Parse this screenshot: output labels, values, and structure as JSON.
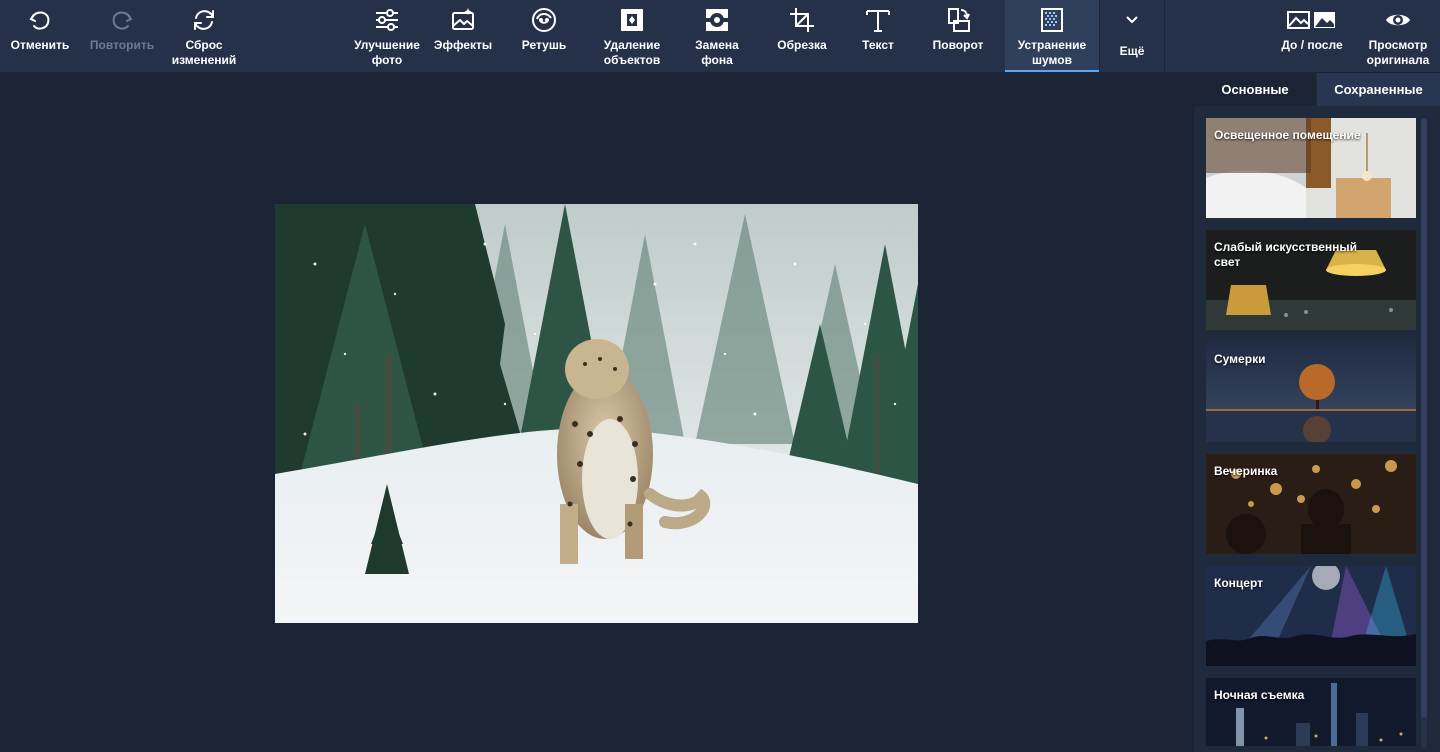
{
  "toolbar": {
    "undo": "Отменить",
    "redo": "Повторить",
    "reset": "Сброс\nизменений",
    "enhance": "Улучшение\nфото",
    "effects": "Эффекты",
    "retouch": "Ретушь",
    "remove_objects": "Удаление\nобъектов",
    "replace_bg": "Замена\nфона",
    "crop": "Обрезка",
    "text": "Текст",
    "rotate": "Поворот",
    "denoise": "Устранение\nшумов",
    "more": "Ещё",
    "before_after": "До / после",
    "view_original": "Просмотр\nоригинала"
  },
  "sidebar": {
    "tabs": [
      "Основные",
      "Сохраненные"
    ],
    "presets": [
      {
        "label": "Освещенное помещение"
      },
      {
        "label": "Слабый искусственный свет"
      },
      {
        "label": "Сумерки"
      },
      {
        "label": "Вечеринка"
      },
      {
        "label": "Концерт"
      },
      {
        "label": "Ночная съемка"
      }
    ]
  },
  "colors": {
    "toolbar_bg": "#243149",
    "canvas_bg": "#1a2435",
    "accent": "#5aa6ff"
  },
  "icons": [
    "undo-icon",
    "redo-icon",
    "reset-icon",
    "sliders-icon",
    "effects-icon",
    "retouch-icon",
    "remove-objects-icon",
    "replace-bg-icon",
    "crop-icon",
    "text-icon",
    "rotate-icon",
    "denoise-icon",
    "chevron-down-icon",
    "before-after-icon",
    "eye-icon"
  ]
}
